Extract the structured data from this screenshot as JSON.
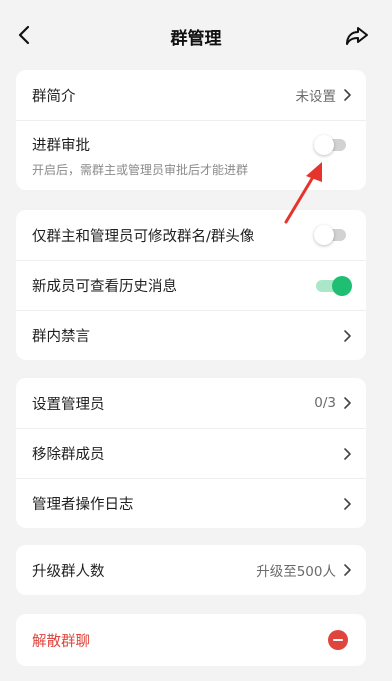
{
  "nav": {
    "title": "群管理",
    "back_icon": "chevron-left-icon",
    "share_icon": "share-icon"
  },
  "group_info": {
    "intro_label": "群简介",
    "intro_value": "未设置",
    "approval_label": "进群审批",
    "approval_desc": "开启后，需群主或管理员审批后才能进群",
    "approval_enabled": false
  },
  "permissions": {
    "rename_label": "仅群主和管理员可修改群名/群头像",
    "rename_enabled": false,
    "history_label": "新成员可查看历史消息",
    "history_enabled": true,
    "mute_label": "群内禁言"
  },
  "admin": {
    "set_admin_label": "设置管理员",
    "set_admin_value": "0/3",
    "remove_member_label": "移除群成员",
    "log_label": "管理者操作日志"
  },
  "upgrade": {
    "label": "升级群人数",
    "value": "升级至500人"
  },
  "dissolve": {
    "label": "解散群聊"
  },
  "colors": {
    "accent_green": "#1fbf73",
    "danger_red": "#e0453d",
    "annotation_red": "#e5342b"
  }
}
